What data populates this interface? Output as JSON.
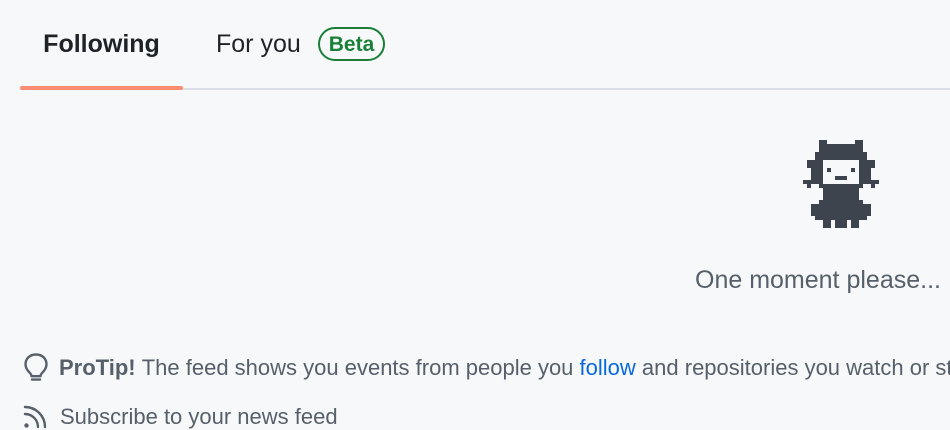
{
  "tabs": {
    "following": "Following",
    "for_you": "For you",
    "beta_badge": "Beta"
  },
  "loading": {
    "message": "One moment please..."
  },
  "protip": {
    "title": "ProTip!",
    "text_before": "The feed shows you events from people you",
    "link": "follow",
    "text_after": "and repositories you watch or star."
  },
  "subscribe": {
    "text": "Subscribe to your news feed"
  },
  "colors": {
    "active_tab_underline": "#fd8c73",
    "beta_green": "#1a7f37",
    "link_blue": "#0969da",
    "muted_text": "#57606a",
    "background": "#f6f8fa"
  },
  "icons": {
    "mascot": "mona-loading-icon",
    "protip": "light-bulb-icon",
    "subscribe": "rss-icon"
  }
}
